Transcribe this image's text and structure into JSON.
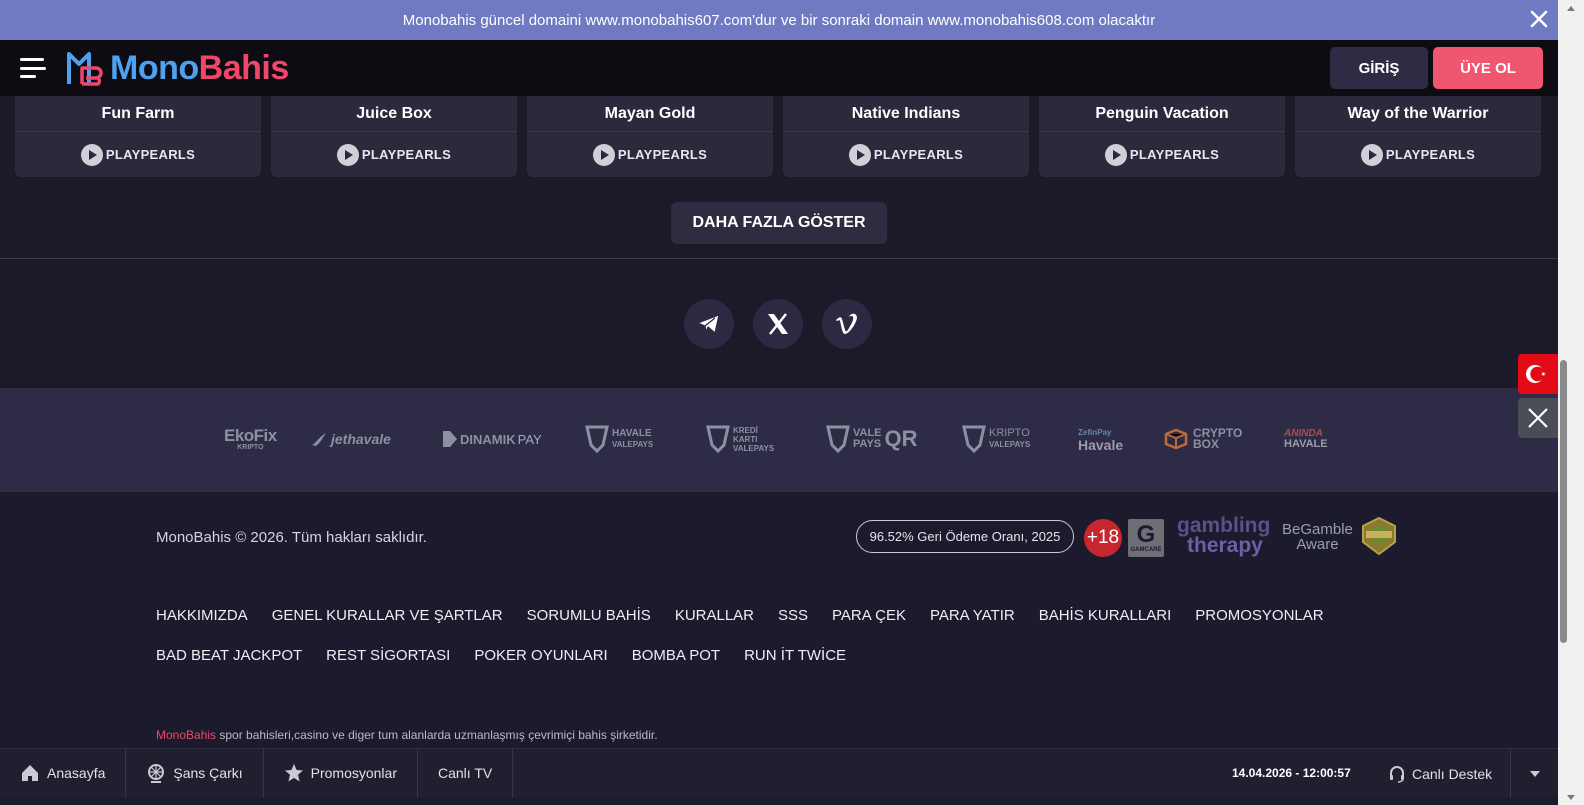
{
  "announcement": {
    "text": "Monobahis güncel domaini www.monobahis607.com'dur ve bir sonraki domain www.monobahis608.com olacaktır"
  },
  "header": {
    "logo_mono": "Mono",
    "logo_bahis": "Bahis",
    "login_label": "GİRİŞ",
    "signup_label": "ÜYE OL",
    "colors": {
      "mono": "#4fa0ee",
      "bahis": "#f0466a",
      "signup_bg": "#f0566f"
    }
  },
  "games": [
    {
      "title": "Fun Farm",
      "provider": "PLAYPEARLS"
    },
    {
      "title": "Juice Box",
      "provider": "PLAYPEARLS"
    },
    {
      "title": "Mayan Gold",
      "provider": "PLAYPEARLS"
    },
    {
      "title": "Native Indians",
      "provider": "PLAYPEARLS"
    },
    {
      "title": "Penguin Vacation",
      "provider": "PLAYPEARLS"
    },
    {
      "title": "Way of the Warrior",
      "provider": "PLAYPEARLS"
    }
  ],
  "show_more_label": "DAHA FAZLA GÖSTER",
  "socials": [
    "telegram-icon",
    "x-icon",
    "vimeo-icon"
  ],
  "payments": {
    "ekofix": "EkoFix",
    "ekofix_sub": "KRIPTO",
    "jethavale": "jethavale",
    "dinamikpay_a": "DINAMIK",
    "dinamikpay_b": "PAY",
    "havale_vp": "HAVALE",
    "havale_vp_sub": "VALEPAYS",
    "kredi_a": "KREDİ",
    "kredi_b": "KARTI",
    "kredi_sub": "VALEPAYS",
    "valepays_qr_a": "VALE",
    "valepays_qr_b": "PAYS",
    "valepays_qr_c": "QR",
    "kripto_vp": "KRIPTO",
    "kripto_vp_sub": "VALEPAYS",
    "zefinpay": "ZefinPay",
    "zefinpay_sub": "Havale",
    "crypto_a": "CRYPTO",
    "crypto_b": "BOX",
    "aninda_a": "ANINDA",
    "aninda_b": "HAVALE"
  },
  "footer": {
    "copyright": "MonoBahis © 2026. Tüm hakları saklıdır.",
    "rtp": "96.52% Geri Ödeme Oranı, 2025",
    "age_badge": "+18",
    "gamcare_letter": "G",
    "gamcare_text": "GAMCARE",
    "gambling_therapy_a": "gambling",
    "gambling_therapy_b": "therapy",
    "begamble_a": "BeGamble",
    "begamble_b": "Aware",
    "links": [
      "HAKKIMIZDA",
      "GENEL KURALLAR VE ŞARTLAR",
      "SORUMLU BAHİS",
      "KURALLAR",
      "SSS",
      "PARA ÇEK",
      "PARA YATIR",
      "BAHİS KURALLARI",
      "PROMOSYONLAR",
      "BAD BEAT JACKPOT",
      "REST SİGORTASI",
      "POKER OYUNLARI",
      "BOMBA POT",
      "RUN İT TWİCE"
    ],
    "tagline_brand": "MonoBahis",
    "tagline_rest": " spor bahisleri,casino ve diger tum alanlarda uzmanlaşmış çevrimiçi bahis şirketidir."
  },
  "bottom_bar": {
    "home": "Anasayfa",
    "wheel": "Şans Çarkı",
    "promotions": "Promosyonlar",
    "live_tv": "Canlı TV",
    "datetime": "14.04.2026 - 12:00:57",
    "support": "Canlı Destek"
  }
}
